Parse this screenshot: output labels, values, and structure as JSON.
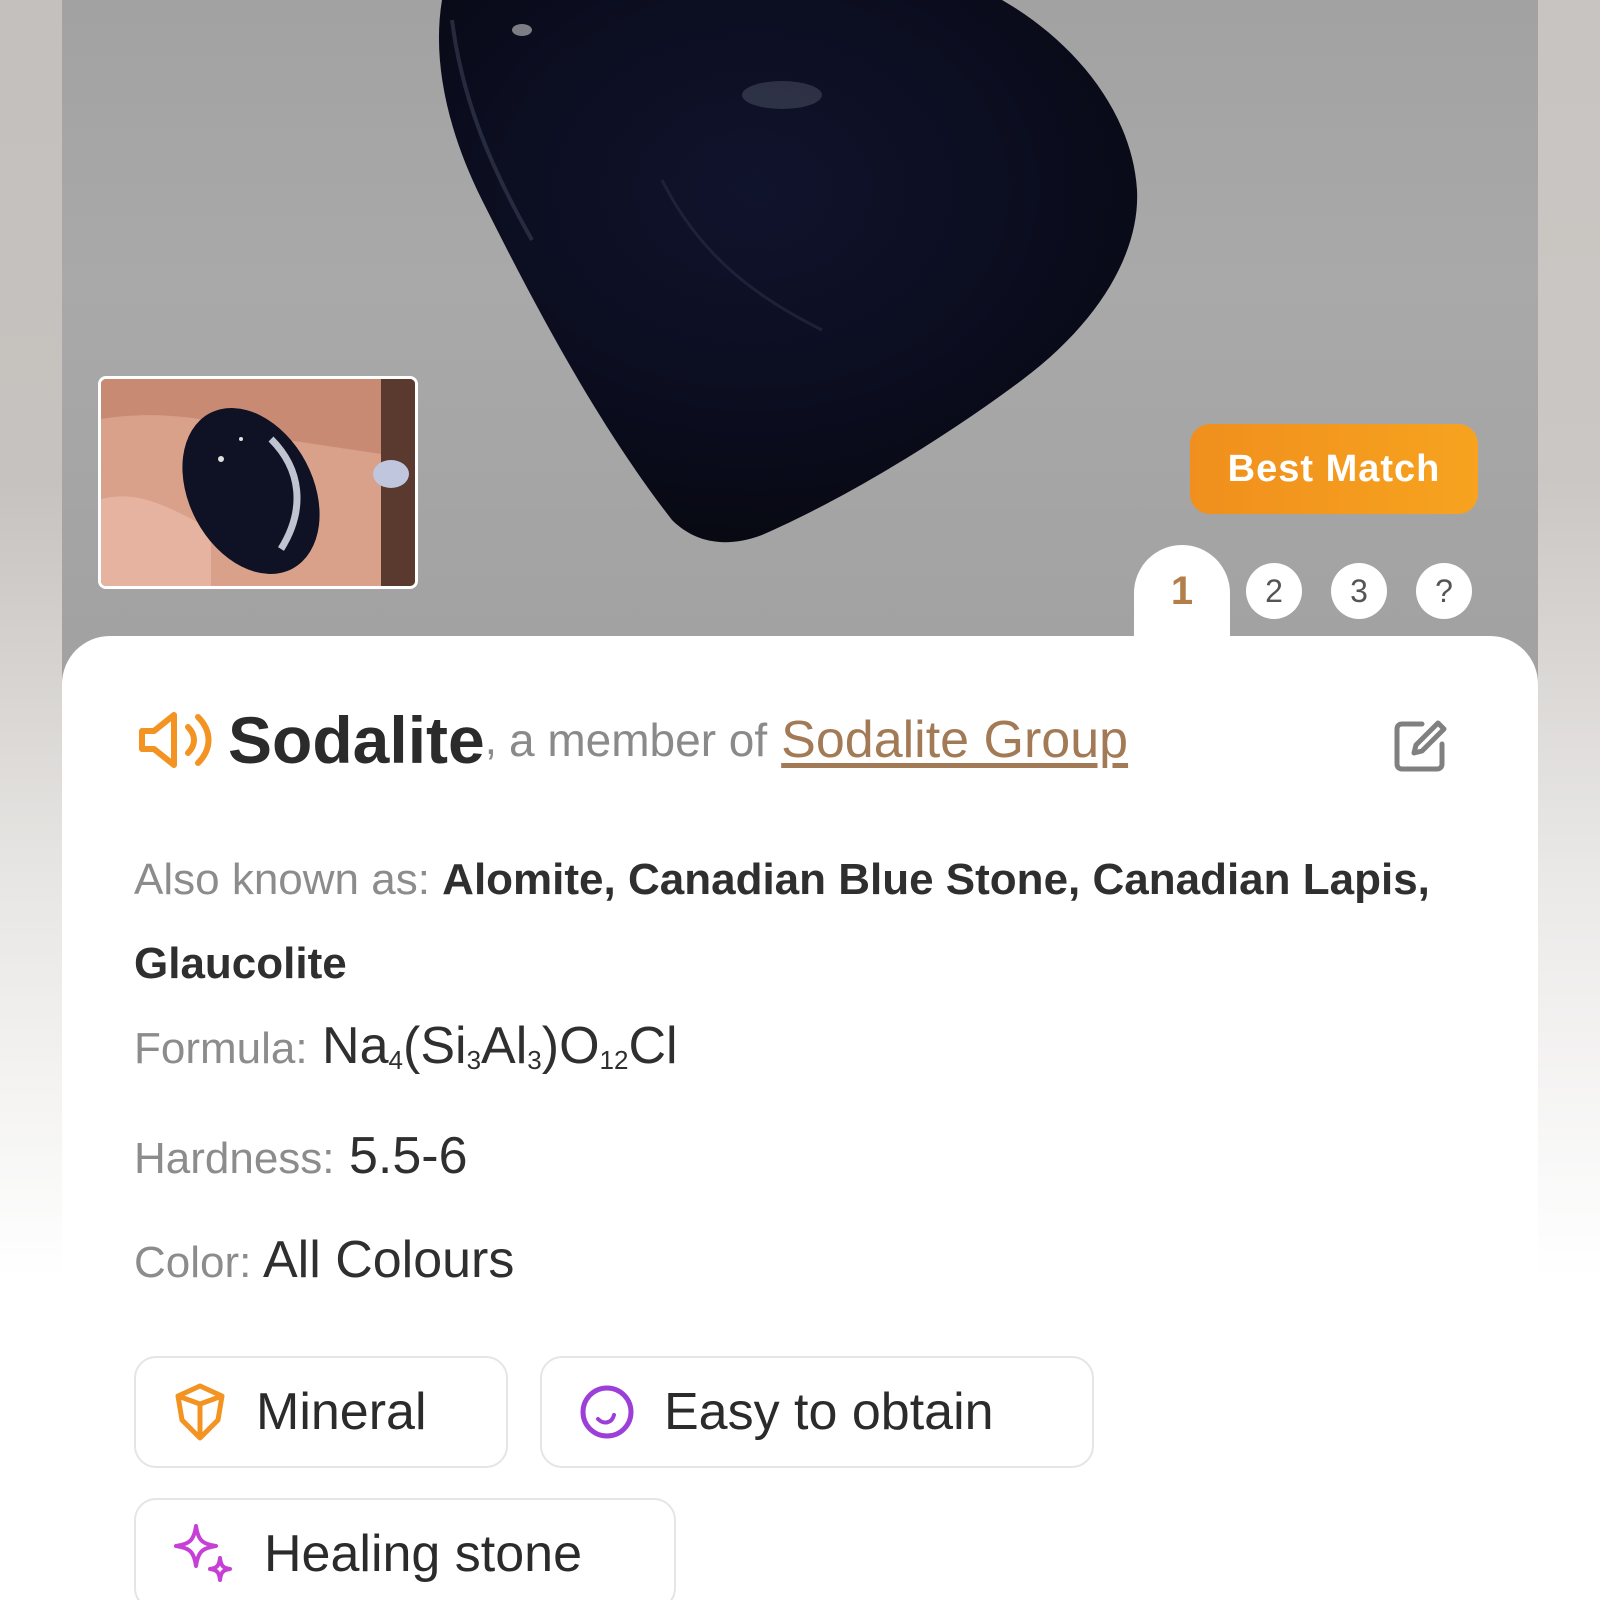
{
  "match": {
    "badge": "Best Match",
    "tabs": [
      "1",
      "2",
      "3",
      "?"
    ]
  },
  "title": {
    "name": "Sodalite",
    "separator": ",",
    "member_text": "a member of",
    "group_link": "Sodalite Group"
  },
  "details": {
    "aka_label": "Also known as:",
    "aka_value": "Alomite, Canadian Blue Stone, Canadian Lapis, Glaucolite",
    "formula_label": "Formula:",
    "formula_parts": [
      "Na",
      "4",
      "(Si",
      "3",
      "Al",
      "3",
      ")O",
      "12",
      "Cl"
    ],
    "hardness_label": "Hardness:",
    "hardness_value": "5.5-6",
    "color_label": "Color:",
    "color_value": "All Colours"
  },
  "tags": {
    "mineral": "Mineral",
    "easy": "Easy to obtain",
    "healing": "Healing stone"
  },
  "icons": {
    "speaker": "speaker-icon",
    "edit": "edit-icon",
    "mineral": "crystal-icon",
    "easy": "circle-icon",
    "healing": "sparkle-icon"
  },
  "colors": {
    "accent_orange": "#f29322",
    "link_brown": "#a27a56",
    "tab_active": "#b37e4a",
    "easy_purple": "#9b3fd8",
    "healing_magenta": "#c63fd6"
  }
}
